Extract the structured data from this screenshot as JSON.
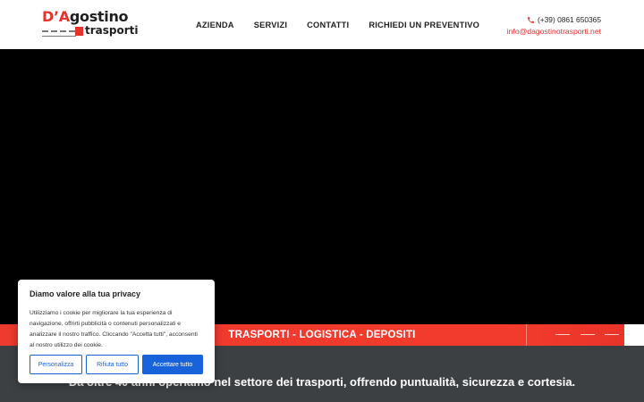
{
  "header": {
    "logo": {
      "line1_prefix": "D’A",
      "line1_rest": "gostino",
      "line2": "trasporti"
    },
    "nav": [
      "AZIENDA",
      "SERVIZI",
      "CONTATTI",
      "RICHIEDI UN PREVENTIVO"
    ],
    "phone": "(+39) 0861 650365",
    "email": "info@dagostinotrasporti.net"
  },
  "band": {
    "text": "TRASPORTI - LOGISTICA - DEPOSITI"
  },
  "tagline": "Da oltre 40 anni operiamo nel settore dei trasporti, offrendo puntualità, sicurezza e cortesia.",
  "cookie": {
    "title": "Diamo valore alla tua privacy",
    "body": "Utilizziamo i cookie per migliorare la tua esperienza di navigazione, offrirti pubblicità o contenuti personalizzati e analizzare il nostro traffico. Cliccando \"Accetta tutti\", acconsenti al nostro utilizzo dei cookie.",
    "buttons": {
      "customize": "Personalizza",
      "reject": "Rifiuta tutto",
      "accept": "Accettare tutto"
    }
  },
  "colors": {
    "brand_red": "#e5322d",
    "cookie_blue": "#1863dc",
    "dark_strip": "#3c4043"
  },
  "icons": {
    "phone": "phone-icon"
  }
}
